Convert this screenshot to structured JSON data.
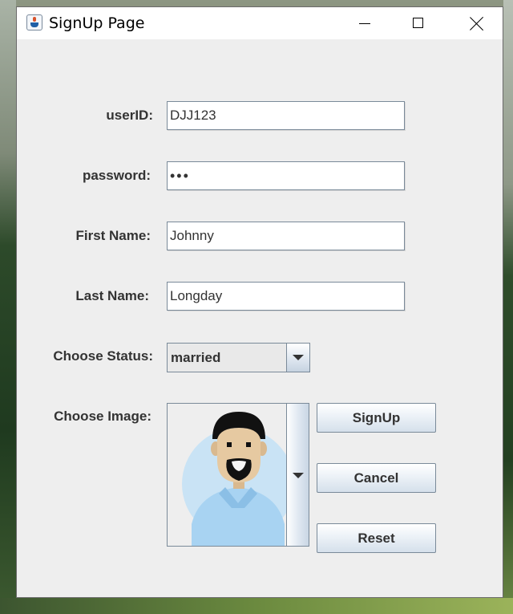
{
  "window": {
    "title": "SignUp Page"
  },
  "form": {
    "user_id": {
      "label": "userID:",
      "value": "DJJ123"
    },
    "password": {
      "label": "password:",
      "value": "•••"
    },
    "first_name": {
      "label": "First Name:",
      "value": "Johnny"
    },
    "last_name": {
      "label": "Last Name:",
      "value": "Longday"
    },
    "status": {
      "label": "Choose Status:",
      "selected": "married"
    },
    "image": {
      "label": "Choose Image:",
      "selected_icon": "man-avatar-icon"
    }
  },
  "buttons": {
    "signup": "SignUp",
    "cancel": "Cancel",
    "reset": "Reset"
  },
  "colors": {
    "window_bg": "#eeeeee",
    "field_border": "#7a8a99",
    "button_gradient_bottom": "#d5e0eb",
    "avatar_bg": "#c9e3f5"
  }
}
